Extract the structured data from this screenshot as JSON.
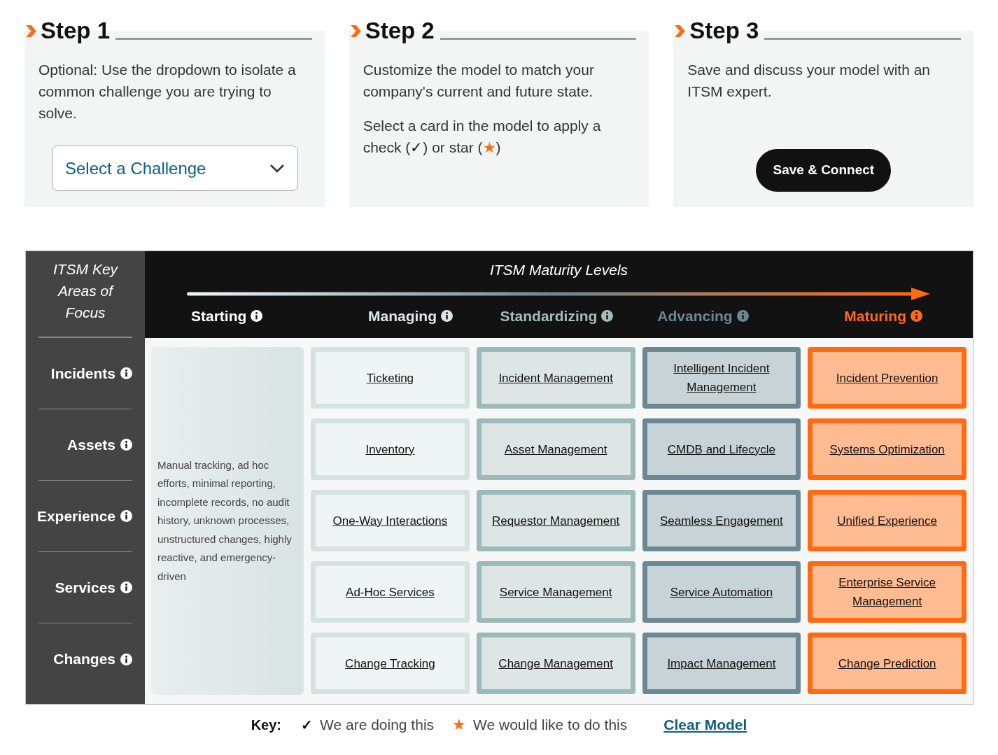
{
  "steps": [
    {
      "title": "Step 1",
      "paragraphs": [
        [
          {
            "text": "Optional: Use the dropdown to isolate a common challenge you are trying to solve."
          }
        ]
      ],
      "control": {
        "kind": "dropdown",
        "label": "Select a Challenge"
      }
    },
    {
      "title": "Step 2",
      "paragraphs": [
        [
          {
            "text": "Customize the model to match your company's current and future state."
          }
        ],
        [
          {
            "text": "Select a card in the model to apply a check ("
          },
          {
            "kind": "check",
            "text": "✓"
          },
          {
            "text": ") or star ("
          },
          {
            "kind": "star",
            "text": "★"
          },
          {
            "text": ")"
          }
        ]
      ]
    },
    {
      "title": "Step 3",
      "paragraphs": [
        [
          {
            "text": "Save and discuss your model with an ITSM expert."
          }
        ]
      ],
      "control": {
        "kind": "button",
        "label": "Save & Connect"
      }
    }
  ],
  "model": {
    "areas_title": "ITSM Key Areas of Focus",
    "levels_title": "ITSM Maturity Levels",
    "levels": [
      {
        "name": "Starting",
        "color": "#ffffff"
      },
      {
        "name": "Managing",
        "color": "#dde7e7"
      },
      {
        "name": "Standardizing",
        "color": "#a3bcbc"
      },
      {
        "name": "Advancing",
        "color": "#6b8995"
      },
      {
        "name": "Maturing",
        "color": "#ff6a13"
      }
    ],
    "starting_description": "Manual tracking, ad hoc efforts, minimal reporting, incomplete records, no audit history, unknown processes, unstructured changes, highly reactive, and emergency-driven",
    "areas": [
      {
        "name": "Incidents",
        "cards": [
          "Ticketing",
          "Incident Management",
          "Intelligent Incident Management",
          "Incident Prevention"
        ]
      },
      {
        "name": "Assets",
        "cards": [
          "Inventory",
          "Asset Management",
          "CMDB and Lifecycle",
          "Systems Optimization"
        ]
      },
      {
        "name": "Experience",
        "cards": [
          "One-Way Interactions",
          "Requestor Management",
          "Seamless Engagement",
          "Unified Experience"
        ]
      },
      {
        "name": "Services",
        "cards": [
          "Ad-Hoc Services",
          "Service Management",
          "Service Automation",
          "Enterprise Service Management"
        ]
      },
      {
        "name": "Changes",
        "cards": [
          "Change Tracking",
          "Change Management",
          "Impact Management",
          "Change Prediction"
        ]
      }
    ]
  },
  "key": {
    "label": "Key:",
    "items": [
      {
        "kind": "check",
        "glyph": "✓",
        "text": "We are doing this"
      },
      {
        "kind": "star",
        "glyph": "★",
        "text": "We would like to do this"
      }
    ],
    "link": "Clear Model"
  }
}
